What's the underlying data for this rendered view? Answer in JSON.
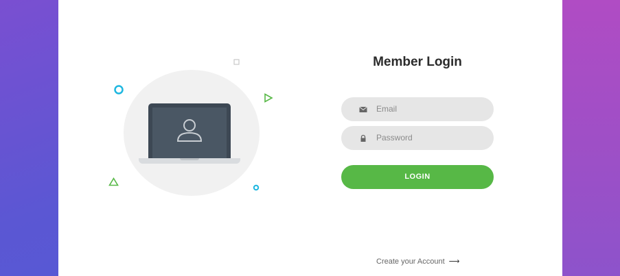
{
  "form": {
    "title": "Member Login",
    "email_placeholder": "Email",
    "password_placeholder": "Password",
    "login_label": "LOGIN"
  },
  "footer": {
    "create_account": "Create your Account",
    "arrow": "⟶"
  },
  "icons": {
    "email": "envelope-icon",
    "password": "lock-icon",
    "user": "user-icon",
    "arrow": "arrow-right-icon"
  },
  "colors": {
    "primary": "#57b846",
    "field_bg": "#e6e6e6",
    "bg_left": "#5b57d3",
    "bg_right": "#a34fc6",
    "deco_blue": "#1eb7e0",
    "deco_green": "#57b846"
  }
}
